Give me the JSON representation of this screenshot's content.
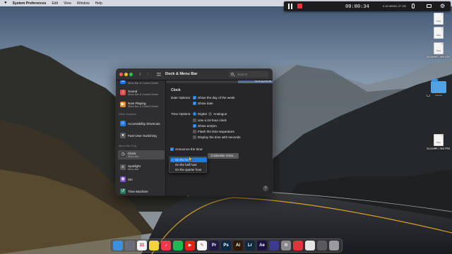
{
  "menubar": {
    "app_name": "System Preferences",
    "items": [
      "Edit",
      "View",
      "Window",
      "Help"
    ]
  },
  "recorder": {
    "elapsed": "00:00:34",
    "file_size": "6.48 MB/81.27 GB"
  },
  "desktop_icons": [
    {
      "label": "",
      "sub": "",
      "ext": "PNG"
    },
    {
      "label": "",
      "sub": "",
      "ext": "PNG"
    },
    {
      "label": "Screen....00 AM",
      "sub": "406 × 345",
      "ext": "PNG"
    },
    {
      "label": "LJ",
      "sub": "4 items",
      "ext": ""
    },
    {
      "label": "Screen....14 PM",
      "sub": "406 × 414",
      "ext": "PNG"
    }
  ],
  "window": {
    "title": "Dock & Menu Bar",
    "search_placeholder": "Search",
    "status_preview": "Tue 31 Aug  5:21 PM"
  },
  "sidebar": {
    "partial_top": {
      "subtitle": "Menu Bar & Control Centre"
    },
    "items_top": [
      {
        "name": "sound",
        "title": "Sound",
        "subtitle": "Menu Bar & Control Centre",
        "color": "#e94d4d"
      },
      {
        "name": "now-playing",
        "title": "Now Playing",
        "subtitle": "Menu Bar & Control Centre",
        "color": "#f28a1e"
      }
    ],
    "other_modules_label": "Other Modules",
    "other_modules": [
      {
        "name": "accessibility-shortcuts",
        "title": "Accessibility Shortcuts",
        "color": "#1f7ae0"
      },
      {
        "name": "fast-user-switching",
        "title": "Fast User Switching",
        "color": "#5a5a5e"
      }
    ],
    "menu_bar_only_label": "Menu Bar Only",
    "menu_bar_only": [
      {
        "name": "clock",
        "title": "Clock",
        "subtitle": "Menu Bar",
        "color": "#3a3a3c",
        "active": true
      },
      {
        "name": "spotlight",
        "title": "Spotlight",
        "subtitle": "Menu Bar",
        "color": "#5a5a5e"
      },
      {
        "name": "siri",
        "title": "Siri",
        "color": "#7b4fd1"
      },
      {
        "name": "time-machine",
        "title": "Time Machine",
        "color": "#2b7a5e"
      }
    ]
  },
  "clock_pane": {
    "heading": "Clock",
    "date_options_label": "Date Options:",
    "show_day_of_week": "Show the day of the week",
    "show_date": "Show date",
    "time_options_label": "Time Options:",
    "digital": "Digital",
    "analogue": "Analogue",
    "use_24_hour": "Use a 24-hour clock",
    "show_ampm": "Show am/pm",
    "flash_separators": "Flash the time separators",
    "display_seconds": "Display the time with seconds",
    "announce_time": "Announce the time:",
    "customise_voice": "Customise Voice..."
  },
  "announce_dropdown": {
    "options": [
      "On the hour",
      "On the half hour",
      "On the quarter hour"
    ],
    "selected_index": 0
  },
  "dock": {
    "apps": [
      {
        "name": "finder",
        "glyph": "",
        "color": "#3d8fe0"
      },
      {
        "name": "launchpad",
        "glyph": "",
        "color": "#6a6e78"
      },
      {
        "name": "calendar",
        "glyph": "31",
        "color": "#f4f4f4"
      },
      {
        "name": "notes",
        "glyph": "",
        "color": "#f5d33c"
      },
      {
        "name": "music",
        "glyph": "♪",
        "color": "#f2384d"
      },
      {
        "name": "spotify",
        "glyph": "",
        "color": "#1db954"
      },
      {
        "name": "youtube",
        "glyph": "▶",
        "color": "#e62117"
      },
      {
        "name": "drafts",
        "glyph": "✎",
        "color": "#f4f4f4"
      },
      {
        "name": "premiere-pro",
        "glyph": "Pr",
        "color": "#1f1a47"
      },
      {
        "name": "photoshop",
        "glyph": "Ps",
        "color": "#0c2a45"
      },
      {
        "name": "illustrator",
        "glyph": "Ai",
        "color": "#2e1a06"
      },
      {
        "name": "lightroom",
        "glyph": "Lr",
        "color": "#0f2a3f"
      },
      {
        "name": "after-effects",
        "glyph": "Ae",
        "color": "#1a1240"
      },
      {
        "name": "imovie-like",
        "glyph": "",
        "color": "#3b3b8f"
      },
      {
        "name": "system-preferences",
        "glyph": "⚙",
        "color": "#8a8a8e"
      },
      {
        "name": "screen-recorder",
        "glyph": "",
        "color": "#e0343a"
      },
      {
        "name": "chrome",
        "glyph": "",
        "color": "#e5e5e5"
      },
      {
        "name": "downloads",
        "glyph": "",
        "color": "#5a5a5e"
      },
      {
        "name": "trash",
        "glyph": "",
        "color": "#9a9a9e"
      }
    ]
  }
}
